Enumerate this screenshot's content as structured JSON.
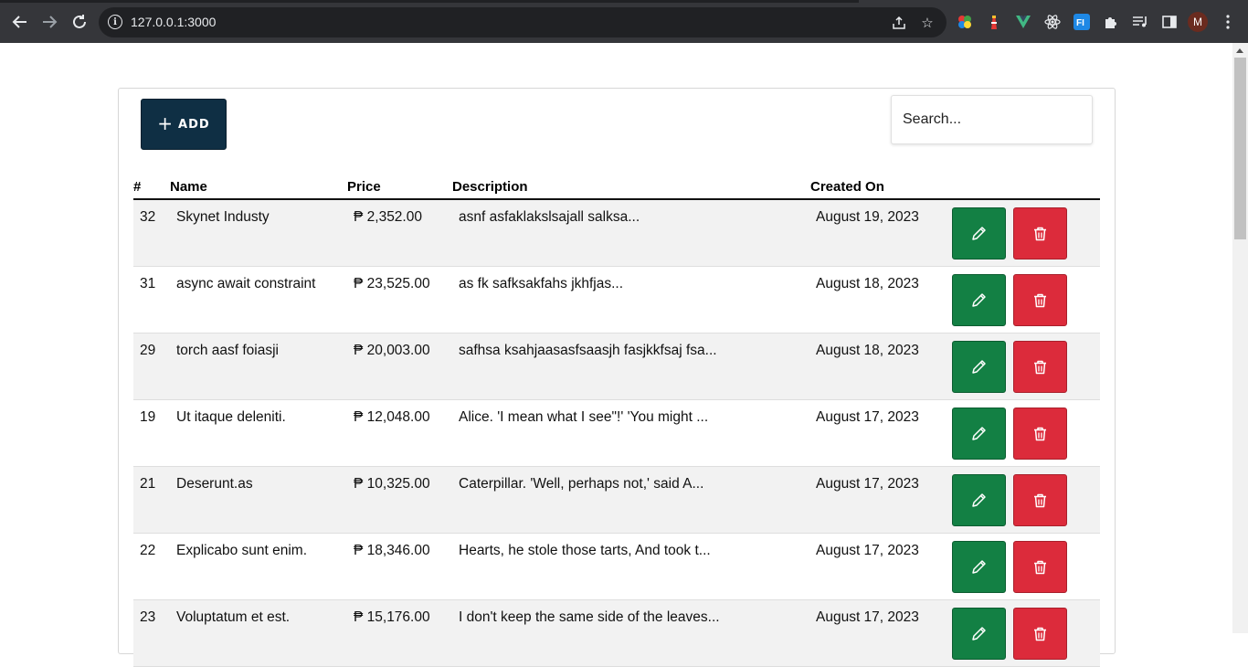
{
  "browser": {
    "url": "127.0.0.1:3000",
    "profile_initial": "M",
    "extensions": [
      "color-wheel-icon",
      "lighthouse-icon",
      "vue-icon",
      "react-icon",
      "fi-icon",
      "puzzle-icon",
      "media-icon",
      "sidepanel-icon"
    ]
  },
  "toolbar": {
    "add_label": "ADD",
    "search_placeholder": "Search..."
  },
  "table": {
    "headers": {
      "num": "#",
      "name": "Name",
      "price": "Price",
      "description": "Description",
      "created": "Created On"
    },
    "rows": [
      {
        "id": "32",
        "name": "Skynet Industy",
        "price": "₱ 2,352.00",
        "description": "asnf asfaklakslsajall salksa...",
        "created": "August 19, 2023"
      },
      {
        "id": "31",
        "name": "async await constraint",
        "price": "₱ 23,525.00",
        "description": "as fk safksakfahs jkhfjas...",
        "created": "August 18, 2023"
      },
      {
        "id": "29",
        "name": "torch aasf foiasji",
        "price": "₱ 20,003.00",
        "description": "safhsa ksahjaasasfsaasjh fasjkkfsaj fsa...",
        "created": "August 18, 2023"
      },
      {
        "id": "19",
        "name": "Ut itaque deleniti.",
        "price": "₱ 12,048.00",
        "description": "Alice. 'I mean what I see\"!' 'You might ...",
        "created": "August 17, 2023"
      },
      {
        "id": "21",
        "name": "Deserunt.as",
        "price": "₱ 10,325.00",
        "description": "Caterpillar. 'Well, perhaps not,' said A...",
        "created": "August 17, 2023"
      },
      {
        "id": "22",
        "name": "Explicabo sunt enim.",
        "price": "₱ 18,346.00",
        "description": "Hearts, he stole those tarts, And took t...",
        "created": "August 17, 2023"
      },
      {
        "id": "23",
        "name": "Voluptatum et est.",
        "price": "₱ 15,176.00",
        "description": "I don't keep the same side of the leaves...",
        "created": "August 17, 2023"
      }
    ]
  },
  "colors": {
    "add_button": "#0f2f44",
    "edit_button": "#138044",
    "delete_button": "#dc2b3b",
    "striped_row": "#f2f2f2"
  }
}
